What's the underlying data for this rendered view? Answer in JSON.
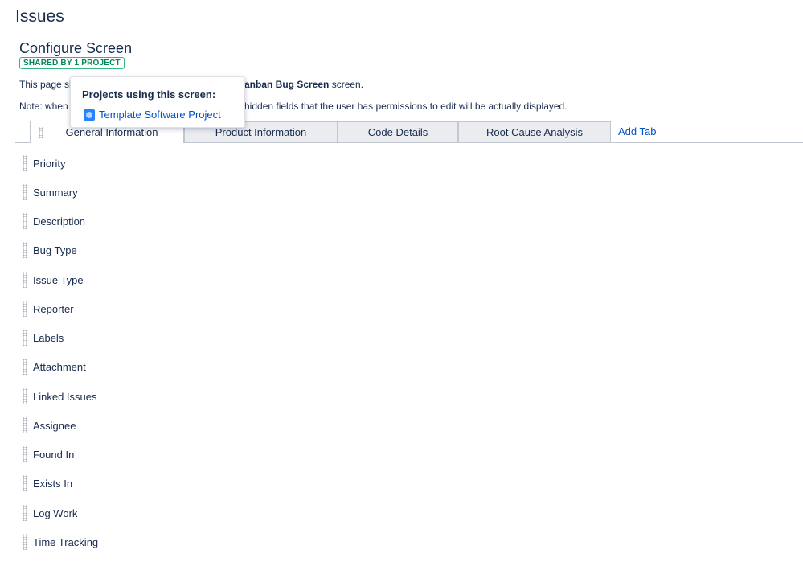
{
  "page": {
    "title": "Issues"
  },
  "screen": {
    "title": "Configure Screen",
    "shared_badge": "SHARED BY 1 PROJECT",
    "info_line1_start": "This page sh",
    "info_line1_bold": "anban Bug Screen",
    "info_line1_end": " screen.",
    "info_line2_start": "Note: when",
    "info_line2_end": "hidden fields that the user has permissions to edit will be actually displayed."
  },
  "popup": {
    "heading": "Projects using this screen:",
    "project_name": "Template Software Project",
    "project_icon": "project-avatar-icon"
  },
  "tabs": [
    {
      "label": "General Information",
      "active": true
    },
    {
      "label": "Product Information",
      "active": false
    },
    {
      "label": "Code Details",
      "active": false
    },
    {
      "label": "Root Cause Analysis",
      "active": false
    }
  ],
  "add_tab_label": "Add Tab",
  "fields": [
    "Priority",
    "Summary",
    "Description",
    "Bug Type",
    "Issue Type",
    "Reporter",
    "Labels",
    "Attachment",
    "Linked Issues",
    "Assignee",
    "Found In",
    "Exists In",
    "Log Work",
    "Time Tracking"
  ]
}
